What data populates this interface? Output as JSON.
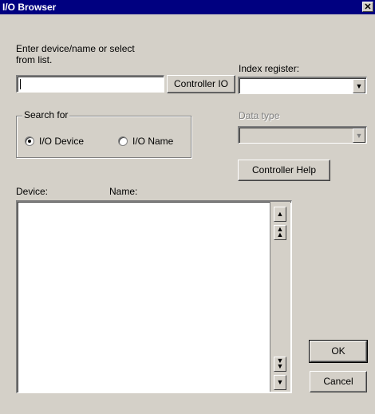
{
  "window": {
    "title": "I/O Browser",
    "close_glyph": "✕"
  },
  "entry": {
    "label_line1": "Enter device/name or select",
    "label_line2": "from list.",
    "value": "",
    "controller_io_label": "Controller IO"
  },
  "index_register": {
    "label": "Index register:",
    "value": ""
  },
  "search_for": {
    "title": "Search for",
    "options": [
      {
        "label": "I/O Device",
        "selected": true
      },
      {
        "label": "I/O Name",
        "selected": false
      }
    ]
  },
  "data_type": {
    "label": "Data type",
    "value": "",
    "enabled": false
  },
  "controller_help_label": "Controller Help",
  "list": {
    "col_device": "Device:",
    "col_name": "Name:",
    "items": []
  },
  "buttons": {
    "ok": "OK",
    "cancel": "Cancel"
  },
  "icons": {
    "dropdown": "triangle-down-icon",
    "scroll_up": "triangle-up-icon",
    "page_up": "double-triangle-up-icon",
    "page_down": "double-triangle-down-icon",
    "scroll_down": "triangle-down-icon"
  },
  "colors": {
    "titlebar": "#000080",
    "face": "#d4d0c8"
  }
}
